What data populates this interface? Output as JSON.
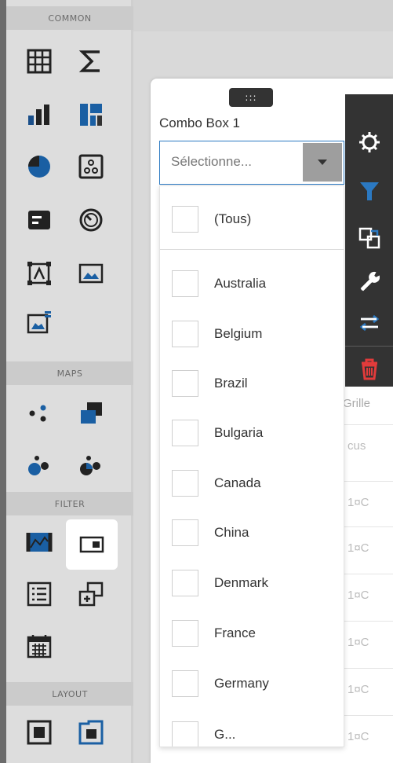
{
  "toolbox": {
    "sections": {
      "common": "COMMON",
      "maps": "MAPS",
      "filter": "FILTER",
      "layout": "LAYOUT"
    },
    "tools": {
      "grid": "grid-icon",
      "sum": "sigma-icon",
      "chart": "bar-chart-icon",
      "treemap": "treemap-icon",
      "pie": "pie-chart-icon",
      "scatter": "scatter-icon",
      "card": "card-icon",
      "gauge": "gauge-icon",
      "bound_image": "bound-image-icon",
      "image": "image-icon",
      "text_box": "text-box-icon",
      "geo_point": "geo-point-map-icon",
      "choropleth": "choropleth-map-icon",
      "bubble_map": "bubble-map-icon",
      "pie_map": "pie-map-icon",
      "range_filter": "range-filter-icon",
      "combo_box": "combo-box-icon",
      "list_box": "list-box-icon",
      "tree_view": "tree-view-icon",
      "date_filter": "date-filter-icon",
      "group": "group-icon",
      "tab_container": "tab-container-icon"
    }
  },
  "item": {
    "drag_handle": ":::",
    "title": "Combo Box 1",
    "combo_placeholder": "Sélectionne...",
    "options": [
      "(Tous)",
      "Australia",
      "Belgium",
      "Brazil",
      "Bulgaria",
      "Canada",
      "China",
      "Denmark",
      "France",
      "Germany",
      "G..."
    ]
  },
  "grid_behind": {
    "title": "Grille",
    "header": "cus",
    "rows": [
      "1¤C",
      "1¤C",
      "1¤C",
      "1¤C",
      "1¤C",
      "1¤C"
    ]
  },
  "colors": {
    "accent": "#2b79c2",
    "delete": "#e23b3b",
    "sidebar": "#333333"
  }
}
